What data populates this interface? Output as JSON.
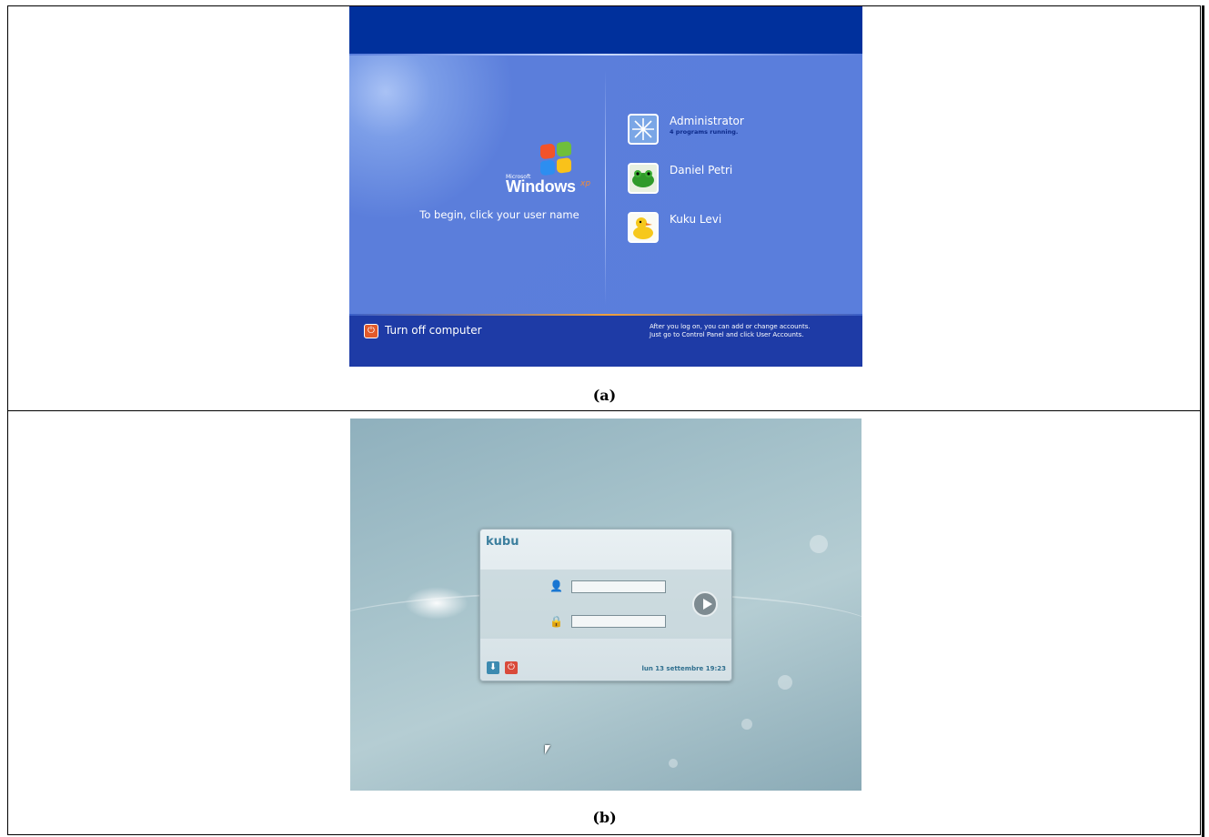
{
  "captions": {
    "a": "(a)",
    "b": "(b)"
  },
  "windows_xp": {
    "logo": {
      "microsoft": "Microsoft",
      "windows": "Windows",
      "xp": "xp"
    },
    "prompt": "To begin, click your user name",
    "users": [
      {
        "name": "Administrator",
        "subtitle": "4 programs running.",
        "avatar_icon": "snowflake-icon"
      },
      {
        "name": "Daniel Petri",
        "subtitle": "",
        "avatar_icon": "frog-icon"
      },
      {
        "name": "Kuku Levi",
        "subtitle": "",
        "avatar_icon": "duck-icon"
      }
    ],
    "turn_off_label": "Turn off computer",
    "hint_line1": "After you log on, you can add or change accounts.",
    "hint_line2": "Just go to Control Panel and click User Accounts.",
    "colors": {
      "topbar": "#00309c",
      "body": "#5a7edc",
      "bottombar": "#1e3ba6",
      "power": "#e25a2a"
    }
  },
  "kubuntu": {
    "title": "kubu",
    "username_value": "",
    "password_value": "",
    "datetime": "lun 13 settembre 19:23",
    "colors": {
      "accent": "#3c7f9e",
      "power": "#d94a3a"
    }
  }
}
